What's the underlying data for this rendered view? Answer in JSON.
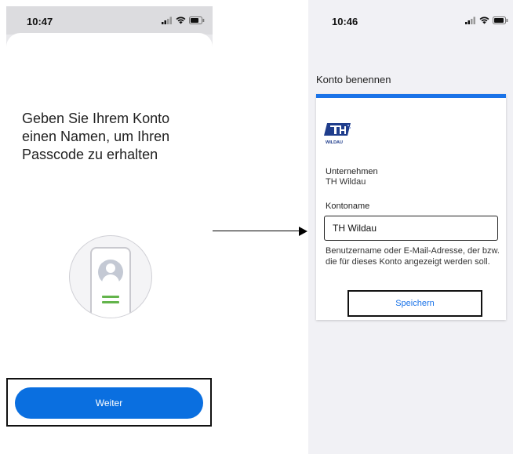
{
  "left_screen": {
    "status_time": "10:47",
    "headline": "Geben Sie Ihrem Konto einen Namen, um Ihren Passcode zu erhalten",
    "continue_button": "Weiter"
  },
  "right_screen": {
    "status_time": "10:46",
    "screen_title": "Konto benennen",
    "logo_text": "WILDAU",
    "company_label": "Unternehmen",
    "company_value": "TH Wildau",
    "account_name_label": "Kontoname",
    "account_name_value": "TH Wildau",
    "helper_text": "Benutzername oder E-Mail-Adresse, der bzw. die für dieses Konto angezeigt werden soll.",
    "save_button": "Speichern"
  },
  "colors": {
    "primary_blue": "#0a6fe0",
    "card_accent": "#1a73e8",
    "illustration_green": "#63b44b"
  },
  "icons": [
    "signal-icon",
    "wifi-icon",
    "battery-icon",
    "avatar-icon",
    "th-wildau-logo",
    "arrow-right-icon"
  ]
}
